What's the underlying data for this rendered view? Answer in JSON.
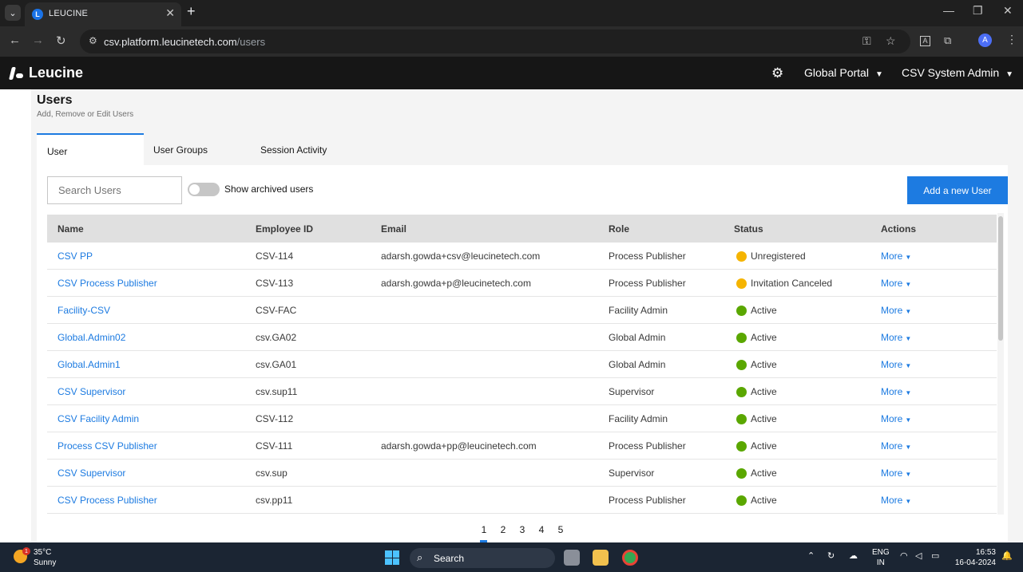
{
  "browser": {
    "tab_title": "LEUCINE",
    "url_host": "csv.platform.leucinetech.com",
    "url_path": "/users",
    "profile_initial": "A",
    "ext_label": "A"
  },
  "app": {
    "brand": "Leucine",
    "portal": "Global Portal",
    "user": "CSV System Admin"
  },
  "page": {
    "title": "Users",
    "subtitle": "Add, Remove or Edit Users",
    "tabs": [
      "User",
      "User Groups",
      "Session Activity"
    ],
    "search_placeholder": "Search Users",
    "toggle_label": "Show archived users",
    "add_button": "Add a new User"
  },
  "table": {
    "headers": [
      "Name",
      "Employee ID",
      "Email",
      "Role",
      "Status",
      "Actions"
    ],
    "rows": [
      {
        "name": "CSV PP",
        "emp": "CSV-114",
        "email": "adarsh.gowda+csv@leucinetech.com",
        "role": "Process Publisher",
        "status": "Unregistered",
        "status_color": "#f5b400",
        "action": "More"
      },
      {
        "name": "CSV Process Publisher",
        "emp": "CSV-113",
        "email": "adarsh.gowda+p@leucinetech.com",
        "role": "Process Publisher",
        "status": "Invitation Canceled",
        "status_color": "#f5b400",
        "action": "More"
      },
      {
        "name": "Facility-CSV",
        "emp": "CSV-FAC",
        "email": "",
        "role": "Facility Admin",
        "status": "Active",
        "status_color": "#5aa700",
        "action": "More"
      },
      {
        "name": "Global.Admin02",
        "emp": "csv.GA02",
        "email": "",
        "role": "Global Admin",
        "status": "Active",
        "status_color": "#5aa700",
        "action": "More"
      },
      {
        "name": "Global.Admin1",
        "emp": "csv.GA01",
        "email": "",
        "role": "Global Admin",
        "status": "Active",
        "status_color": "#5aa700",
        "action": "More"
      },
      {
        "name": "CSV Supervisor",
        "emp": "csv.sup11",
        "email": "",
        "role": "Supervisor",
        "status": "Active",
        "status_color": "#5aa700",
        "action": "More"
      },
      {
        "name": "CSV Facility Admin",
        "emp": "CSV-112",
        "email": "",
        "role": "Facility Admin",
        "status": "Active",
        "status_color": "#5aa700",
        "action": "More"
      },
      {
        "name": "Process CSV Publisher",
        "emp": "CSV-111",
        "email": "adarsh.gowda+pp@leucinetech.com",
        "role": "Process Publisher",
        "status": "Active",
        "status_color": "#5aa700",
        "action": "More"
      },
      {
        "name": "CSV Supervisor",
        "emp": "csv.sup",
        "email": "",
        "role": "Supervisor",
        "status": "Active",
        "status_color": "#5aa700",
        "action": "More"
      },
      {
        "name": "CSV Process Publisher",
        "emp": "csv.pp11",
        "email": "",
        "role": "Process Publisher",
        "status": "Active",
        "status_color": "#5aa700",
        "action": "More"
      }
    ]
  },
  "pagination": {
    "pages": [
      "1",
      "2",
      "3",
      "4",
      "5"
    ],
    "current": "1"
  },
  "taskbar": {
    "temperature": "35°C",
    "condition": "Sunny",
    "weather_badge": "1",
    "search": "Search",
    "lang_top": "ENG",
    "lang_bottom": "IN",
    "time": "16:53",
    "date": "16-04-2024"
  }
}
